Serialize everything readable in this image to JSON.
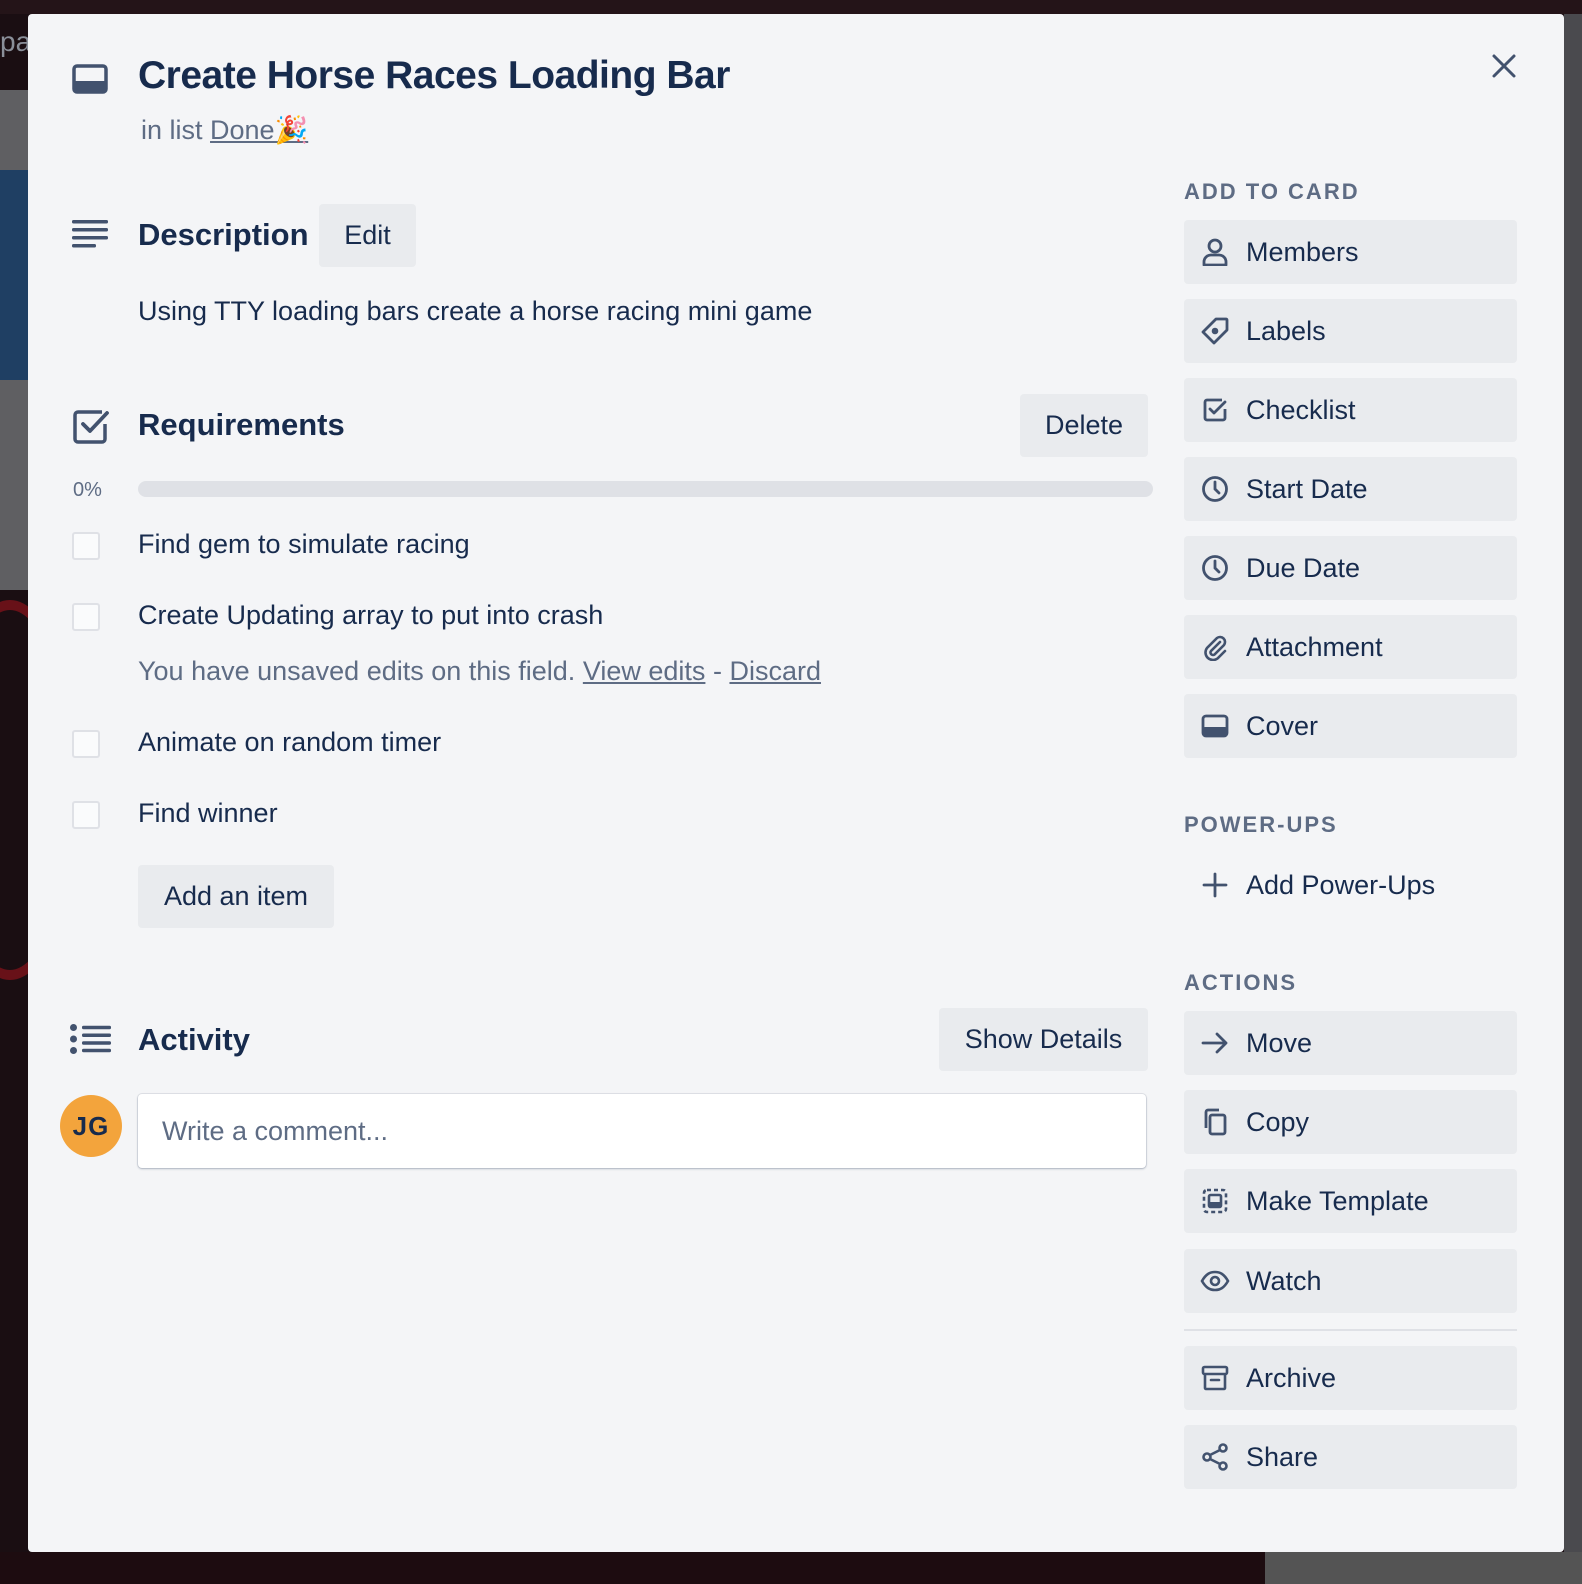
{
  "card": {
    "title": "Create Horse Races Loading Bar",
    "in_list_prefix": "in list",
    "list_name": "Done🎉"
  },
  "description": {
    "heading": "Description",
    "edit_label": "Edit",
    "text": "Using TTY loading bars create a horse racing mini game"
  },
  "checklist": {
    "heading": "Requirements",
    "delete_label": "Delete",
    "progress_label": "0%",
    "progress_fraction": 0,
    "items": [
      {
        "label": "Find gem to simulate racing",
        "checked": false
      },
      {
        "label": "Create Updating array to put into crash",
        "checked": false
      },
      {
        "label": "Animate on random timer",
        "checked": false
      },
      {
        "label": "Find winner",
        "checked": false
      }
    ],
    "unsaved_text": "You have unsaved edits on this field.",
    "view_edits_label": "View edits",
    "separator": "-",
    "discard_label": "Discard",
    "add_item_label": "Add an item"
  },
  "activity": {
    "heading": "Activity",
    "show_details_label": "Show Details",
    "avatar_initials": "JG",
    "comment_placeholder": "Write a comment..."
  },
  "sidebar": {
    "add_to_card_heading": "ADD TO CARD",
    "add_to_card": [
      {
        "label": "Members",
        "icon": "person-icon"
      },
      {
        "label": "Labels",
        "icon": "tag-icon"
      },
      {
        "label": "Checklist",
        "icon": "checkbox-icon"
      },
      {
        "label": "Start Date",
        "icon": "clock-icon"
      },
      {
        "label": "Due Date",
        "icon": "clock-icon"
      },
      {
        "label": "Attachment",
        "icon": "paperclip-icon"
      },
      {
        "label": "Cover",
        "icon": "cover-icon"
      }
    ],
    "power_ups_heading": "POWER-UPS",
    "add_power_ups_label": "Add Power-Ups",
    "actions_heading": "ACTIONS",
    "actions": [
      {
        "label": "Move",
        "icon": "arrow-right-icon"
      },
      {
        "label": "Copy",
        "icon": "copy-icon"
      },
      {
        "label": "Make Template",
        "icon": "template-icon"
      },
      {
        "label": "Watch",
        "icon": "eye-icon"
      },
      {
        "label": "Archive",
        "icon": "archive-icon"
      },
      {
        "label": "Share",
        "icon": "share-icon"
      }
    ]
  },
  "colors": {
    "modal_bg": "#f4f5f7",
    "text": "#172b4d",
    "muted": "#5e6c84",
    "button_bg": "#e9ebee",
    "avatar_bg": "#f3a43c"
  }
}
